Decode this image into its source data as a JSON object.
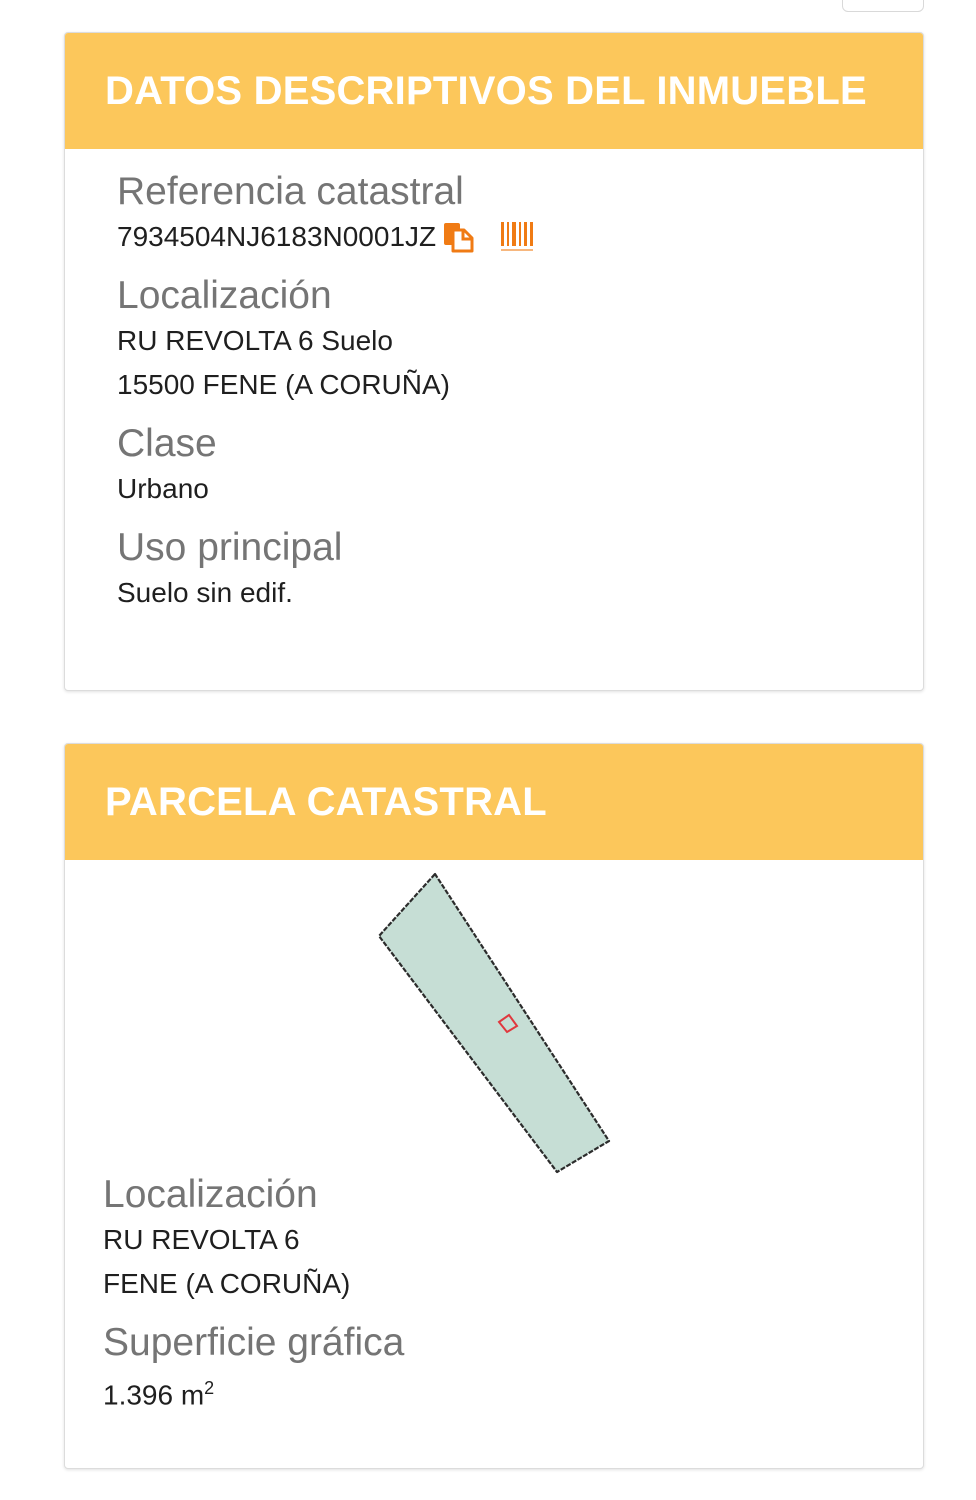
{
  "descriptive_card": {
    "title": "DATOS DESCRIPTIVOS DEL INMUEBLE",
    "reference": {
      "label": "Referencia catastral",
      "value": "7934504NJ6183N0001JZ",
      "copy_icon": "copy-icon",
      "barcode_icon": "barcode-icon"
    },
    "location": {
      "label": "Localización",
      "line1": "RU REVOLTA 6 Suelo",
      "line2": "15500 FENE (A CORUÑA)"
    },
    "class": {
      "label": "Clase",
      "value": "Urbano"
    },
    "use": {
      "label": "Uso principal",
      "value": "Suelo sin edif."
    }
  },
  "parcel_card": {
    "title": "PARCELA CATASTRAL",
    "location": {
      "label": "Localización",
      "line1": "RU REVOLTA 6",
      "line2": "FENE (A CORUÑA)"
    },
    "area": {
      "label": "Superficie gráfica",
      "value": "1.396 m",
      "unit_exponent": "2"
    }
  },
  "colors": {
    "header_bg": "#fcc75b",
    "header_text": "#ffffff",
    "icon_orange": "#f07b14",
    "parcel_fill": "#c6ded5",
    "parcel_marker": "#e0383e"
  }
}
